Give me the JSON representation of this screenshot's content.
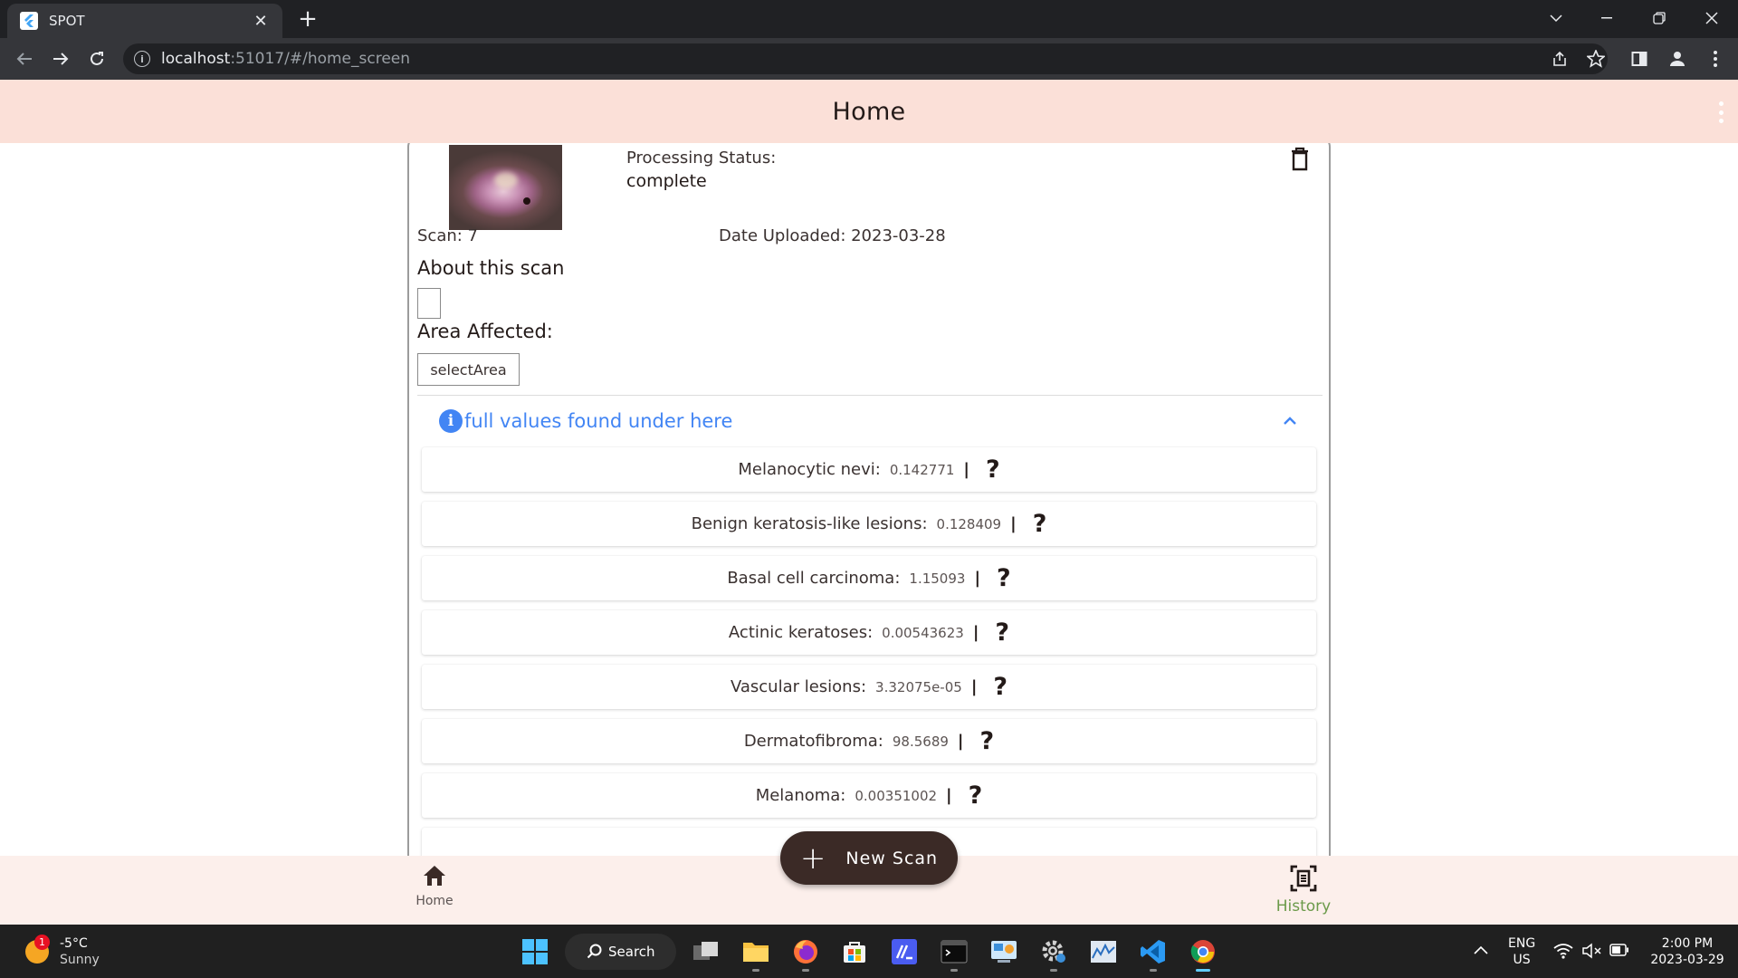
{
  "browser": {
    "tab_title": "SPOT",
    "tab_close": "✕",
    "new_tab": "+",
    "url_host": "localhost",
    "url_rest": ":51017/#/home_screen"
  },
  "appbar": {
    "title": "Home"
  },
  "scan": {
    "processing_status_label": "Processing Status:",
    "processing_status": "complete",
    "scan_label": "Scan: 7",
    "date_uploaded": "Date Uploaded: 2023-03-28",
    "about_label": "About this scan",
    "area_label": "Area Affected:",
    "select_area": "selectArea",
    "expander_text": "full values found under here",
    "results": [
      {
        "label": "Melanocytic nevi:",
        "value": "0.142771",
        "sep": "|",
        "help": "?"
      },
      {
        "label": "Benign keratosis-like lesions:",
        "value": "0.128409",
        "sep": "|",
        "help": "?"
      },
      {
        "label": "Basal cell carcinoma:",
        "value": "1.15093",
        "sep": "|",
        "help": "?"
      },
      {
        "label": "Actinic keratoses:",
        "value": "0.00543623",
        "sep": "|",
        "help": "?"
      },
      {
        "label": "Vascular lesions:",
        "value": "3.32075e-05",
        "sep": "|",
        "help": "?"
      },
      {
        "label": "Dermatofibroma:",
        "value": "98.5689",
        "sep": "|",
        "help": "?"
      },
      {
        "label": "Melanoma:",
        "value": "0.00351002",
        "sep": "|",
        "help": "?"
      }
    ]
  },
  "fab": {
    "icon": "+",
    "label": "New Scan"
  },
  "bottom_nav": {
    "home": "Home",
    "history": "History",
    "active_color": "#6b9a4a"
  },
  "taskbar": {
    "weather_badge": "1",
    "temperature": "-5°C",
    "condition": "Sunny",
    "search_label": "Search",
    "lang": "ENG",
    "region": "US",
    "time": "2:00 PM",
    "date": "2023-03-29"
  },
  "colors": {
    "appbar": "#fbe0d8",
    "accent_blue": "#4285f4",
    "fab": "#3b2a26"
  }
}
